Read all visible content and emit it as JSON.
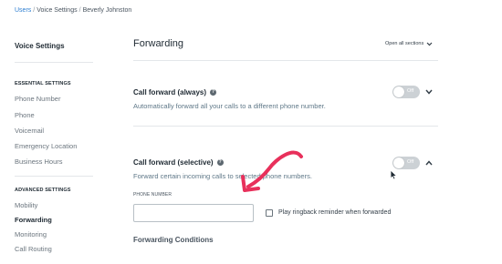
{
  "breadcrumb": [
    {
      "label": "Users",
      "link": true
    },
    {
      "label": "Voice Settings",
      "link": false
    },
    {
      "label": "Beverly Johnston",
      "link": false
    }
  ],
  "breadcrumb_separator": "/",
  "sidebar": {
    "title": "Voice Settings",
    "sections": [
      {
        "heading": "ESSENTIAL SETTINGS",
        "items": [
          "Phone Number",
          "Phone",
          "Voicemail",
          "Emergency Location",
          "Business Hours"
        ]
      },
      {
        "heading": "ADVANCED SETTINGS",
        "items": [
          "Mobility",
          "Forwarding",
          "Monitoring",
          "Call Routing"
        ]
      }
    ],
    "active_item": "Forwarding"
  },
  "main": {
    "title": "Forwarding",
    "open_all_label": "Open all sections",
    "settings": [
      {
        "title": "Call forward (always)",
        "description": "Automatically forward all your calls to a different phone number.",
        "toggle_label": "Off",
        "enabled": false,
        "expanded": false
      },
      {
        "title": "Call forward (selective)",
        "description": "Forward certain incoming calls to selected phone numbers.",
        "toggle_label": "Off",
        "enabled": false,
        "expanded": true
      }
    ],
    "phone_number_label": "PHONE NUMBER",
    "phone_number_value": "",
    "ringback_label": "Play ringback reminder when forwarded",
    "ringback_checked": false,
    "conditions_title": "Forwarding Conditions"
  },
  "colors": {
    "link": "#2f7fd1",
    "toggle_off": "#ccd1d5",
    "annotation_arrow": "#e8305b",
    "description_text": "#5f7888"
  },
  "icons": [
    "help-icon",
    "chevron-down-icon",
    "chevron-up-icon",
    "mouse-cursor-icon",
    "annotation-arrow"
  ]
}
